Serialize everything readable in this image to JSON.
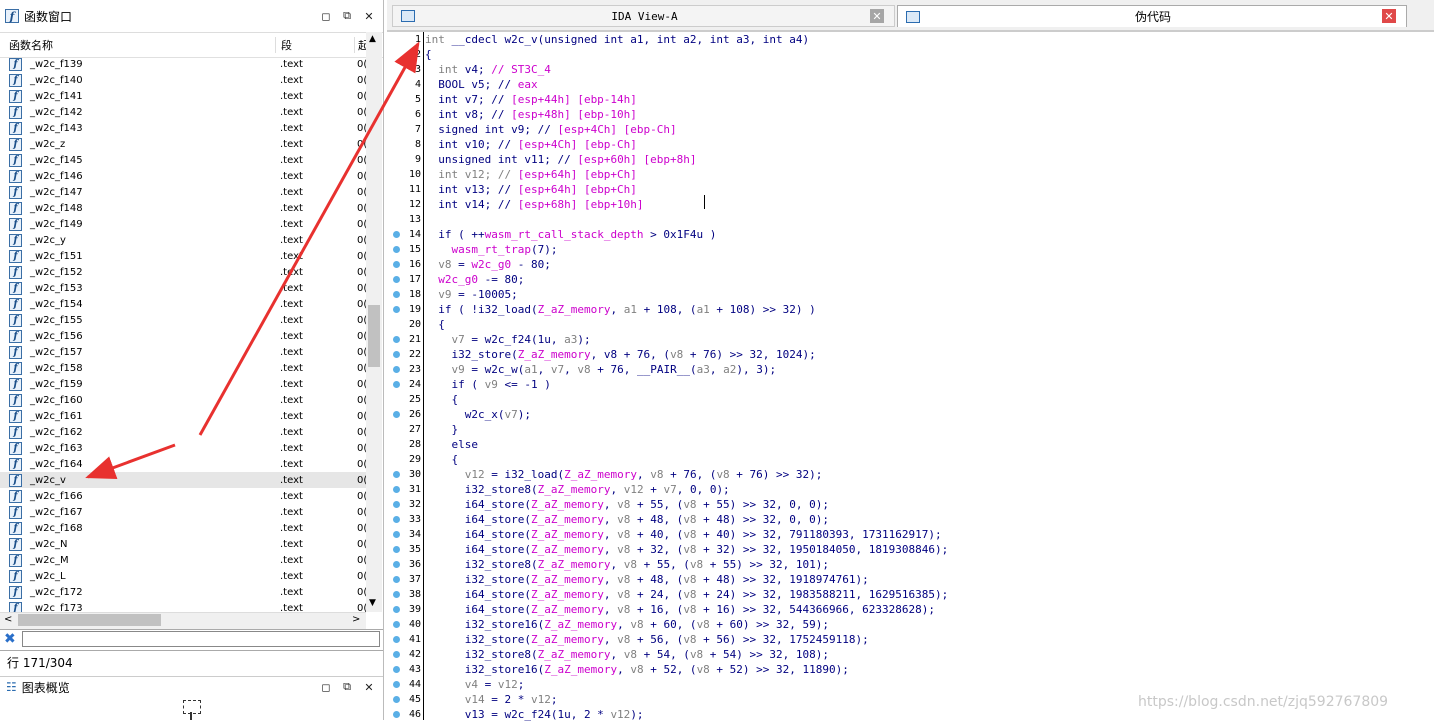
{
  "functions_window": {
    "title": "函数窗口",
    "columns": [
      "函数名称",
      "段",
      "起"
    ],
    "rows": [
      {
        "name": "_w2c_f139",
        "segment": ".text",
        "start": "0("
      },
      {
        "name": "_w2c_f140",
        "segment": ".text",
        "start": "0("
      },
      {
        "name": "_w2c_f141",
        "segment": ".text",
        "start": "0("
      },
      {
        "name": "_w2c_f142",
        "segment": ".text",
        "start": "0("
      },
      {
        "name": "_w2c_f143",
        "segment": ".text",
        "start": "0("
      },
      {
        "name": "_w2c_z",
        "segment": ".text",
        "start": "0("
      },
      {
        "name": "_w2c_f145",
        "segment": ".text",
        "start": "0("
      },
      {
        "name": "_w2c_f146",
        "segment": ".text",
        "start": "0("
      },
      {
        "name": "_w2c_f147",
        "segment": ".text",
        "start": "0("
      },
      {
        "name": "_w2c_f148",
        "segment": ".text",
        "start": "0("
      },
      {
        "name": "_w2c_f149",
        "segment": ".text",
        "start": "0("
      },
      {
        "name": "_w2c_y",
        "segment": ".text",
        "start": "0("
      },
      {
        "name": "_w2c_f151",
        "segment": ".text",
        "start": "0("
      },
      {
        "name": "_w2c_f152",
        "segment": ".text",
        "start": "0("
      },
      {
        "name": "_w2c_f153",
        "segment": ".text",
        "start": "0("
      },
      {
        "name": "_w2c_f154",
        "segment": ".text",
        "start": "0("
      },
      {
        "name": "_w2c_f155",
        "segment": ".text",
        "start": "0("
      },
      {
        "name": "_w2c_f156",
        "segment": ".text",
        "start": "0("
      },
      {
        "name": "_w2c_f157",
        "segment": ".text",
        "start": "0("
      },
      {
        "name": "_w2c_f158",
        "segment": ".text",
        "start": "0("
      },
      {
        "name": "_w2c_f159",
        "segment": ".text",
        "start": "0("
      },
      {
        "name": "_w2c_f160",
        "segment": ".text",
        "start": "0("
      },
      {
        "name": "_w2c_f161",
        "segment": ".text",
        "start": "0("
      },
      {
        "name": "_w2c_f162",
        "segment": ".text",
        "start": "0("
      },
      {
        "name": "_w2c_f163",
        "segment": ".text",
        "start": "0("
      },
      {
        "name": "_w2c_f164",
        "segment": ".text",
        "start": "0("
      },
      {
        "name": "_w2c_v",
        "segment": ".text",
        "start": "0(",
        "selected": true
      },
      {
        "name": "_w2c_f166",
        "segment": ".text",
        "start": "0("
      },
      {
        "name": "_w2c_f167",
        "segment": ".text",
        "start": "0("
      },
      {
        "name": "_w2c_f168",
        "segment": ".text",
        "start": "0("
      },
      {
        "name": "_w2c_N",
        "segment": ".text",
        "start": "0("
      },
      {
        "name": "_w2c_M",
        "segment": ".text",
        "start": "0("
      },
      {
        "name": "_w2c_L",
        "segment": ".text",
        "start": "0("
      },
      {
        "name": "_w2c_f172",
        "segment": ".text",
        "start": "0("
      },
      {
        "name": "_w2c_f173",
        "segment": ".text",
        "start": "0("
      }
    ],
    "row_status": "行 171/304"
  },
  "graph_overview": {
    "title": "图表概览"
  },
  "tabs": [
    {
      "label": "IDA View-A",
      "close_icon": "close-icon-gray"
    },
    {
      "label": "伪代码",
      "close_icon": "close-icon-red"
    }
  ],
  "code": [
    {
      "n": "1",
      "dot": false,
      "parts": [
        [
          "g",
          "int"
        ],
        [
          "k",
          " __cdecl w2c_v(unsigned int a1, int a2, int a3, int a4)"
        ]
      ]
    },
    {
      "n": "2",
      "dot": false,
      "parts": [
        [
          "k",
          "{"
        ]
      ]
    },
    {
      "n": "3",
      "dot": false,
      "parts": [
        [
          "g",
          "  int"
        ],
        [
          "k",
          " v4; "
        ],
        [
          "m",
          "// ST3C_4"
        ]
      ]
    },
    {
      "n": "4",
      "dot": false,
      "parts": [
        [
          "k",
          "  BOOL v5; // "
        ],
        [
          "m",
          "eax"
        ]
      ]
    },
    {
      "n": "5",
      "dot": false,
      "parts": [
        [
          "k",
          "  int v7; // "
        ],
        [
          "m",
          "[esp+44h] [ebp-14h]"
        ]
      ]
    },
    {
      "n": "6",
      "dot": false,
      "parts": [
        [
          "k",
          "  int v8; // "
        ],
        [
          "m",
          "[esp+48h] [ebp-10h]"
        ]
      ]
    },
    {
      "n": "7",
      "dot": false,
      "parts": [
        [
          "k",
          "  signed int v9; // "
        ],
        [
          "m",
          "[esp+4Ch] [ebp-Ch]"
        ]
      ]
    },
    {
      "n": "8",
      "dot": false,
      "parts": [
        [
          "k",
          "  int v10; // "
        ],
        [
          "m",
          "[esp+4Ch] [ebp-Ch]"
        ]
      ]
    },
    {
      "n": "9",
      "dot": false,
      "parts": [
        [
          "k",
          "  unsigned int v11; // "
        ],
        [
          "m",
          "[esp+60h] [ebp+8h]"
        ]
      ]
    },
    {
      "n": "10",
      "dot": false,
      "parts": [
        [
          "g",
          "  int v12; // "
        ],
        [
          "m",
          "[esp+64h] [ebp+Ch]"
        ]
      ]
    },
    {
      "n": "11",
      "dot": false,
      "parts": [
        [
          "k",
          "  int v13; // "
        ],
        [
          "m",
          "[esp+64h] [ebp+Ch]"
        ]
      ]
    },
    {
      "n": "12",
      "dot": false,
      "parts": [
        [
          "k",
          "  int v14; // "
        ],
        [
          "m",
          "[esp+68h] [ebp+10h]"
        ]
      ]
    },
    {
      "n": "13",
      "dot": false,
      "parts": [
        [
          "k",
          ""
        ]
      ]
    },
    {
      "n": "14",
      "dot": true,
      "parts": [
        [
          "k",
          "  if ( ++"
        ],
        [
          "m",
          "wasm_rt_call_stack_depth"
        ],
        [
          "k",
          " > 0x1F4u )"
        ]
      ]
    },
    {
      "n": "15",
      "dot": true,
      "parts": [
        [
          "m",
          "    wasm_rt_trap"
        ],
        [
          "k",
          "(7);"
        ]
      ]
    },
    {
      "n": "16",
      "dot": true,
      "parts": [
        [
          "g",
          "  v8"
        ],
        [
          "k",
          " = "
        ],
        [
          "m",
          "w2c_g0"
        ],
        [
          "k",
          " - 80;"
        ]
      ]
    },
    {
      "n": "17",
      "dot": true,
      "parts": [
        [
          "m",
          "  w2c_g0"
        ],
        [
          "k",
          " -= 80;"
        ]
      ]
    },
    {
      "n": "18",
      "dot": true,
      "parts": [
        [
          "g",
          "  v9"
        ],
        [
          "k",
          " = -10005;"
        ]
      ]
    },
    {
      "n": "19",
      "dot": true,
      "parts": [
        [
          "k",
          "  if ( !i32_load("
        ],
        [
          "m",
          "Z_aZ_memory"
        ],
        [
          "k",
          ", "
        ],
        [
          "g",
          "a1"
        ],
        [
          "k",
          " + 108, ("
        ],
        [
          "g",
          "a1"
        ],
        [
          "k",
          " + 108) >> 32) )"
        ]
      ]
    },
    {
      "n": "20",
      "dot": false,
      "parts": [
        [
          "k",
          "  {"
        ]
      ]
    },
    {
      "n": "21",
      "dot": true,
      "parts": [
        [
          "g",
          "    v7"
        ],
        [
          "k",
          " = w2c_f24(1u, "
        ],
        [
          "g",
          "a3"
        ],
        [
          "k",
          ");"
        ]
      ]
    },
    {
      "n": "22",
      "dot": true,
      "parts": [
        [
          "k",
          "    i32_store("
        ],
        [
          "m",
          "Z_aZ_memory"
        ],
        [
          "k",
          ", v8 + 76, ("
        ],
        [
          "g",
          "v8"
        ],
        [
          "k",
          " + 76) >> 32, 1024);"
        ]
      ]
    },
    {
      "n": "23",
      "dot": true,
      "parts": [
        [
          "g",
          "    v9"
        ],
        [
          "k",
          " = w2c_w("
        ],
        [
          "g",
          "a1"
        ],
        [
          "k",
          ", "
        ],
        [
          "g",
          "v7"
        ],
        [
          "k",
          ", "
        ],
        [
          "g",
          "v8"
        ],
        [
          "k",
          " + 76, __PAIR__("
        ],
        [
          "g",
          "a3"
        ],
        [
          "k",
          ", "
        ],
        [
          "g",
          "a2"
        ],
        [
          "k",
          "), 3);"
        ]
      ]
    },
    {
      "n": "24",
      "dot": true,
      "parts": [
        [
          "k",
          "    if ( "
        ],
        [
          "g",
          "v9"
        ],
        [
          "k",
          " <= -1 )"
        ]
      ]
    },
    {
      "n": "25",
      "dot": false,
      "parts": [
        [
          "k",
          "    {"
        ]
      ]
    },
    {
      "n": "26",
      "dot": true,
      "parts": [
        [
          "k",
          "      w2c_x("
        ],
        [
          "g",
          "v7"
        ],
        [
          "k",
          ");"
        ]
      ]
    },
    {
      "n": "27",
      "dot": false,
      "parts": [
        [
          "k",
          "    }"
        ]
      ]
    },
    {
      "n": "28",
      "dot": false,
      "parts": [
        [
          "k",
          "    else"
        ]
      ]
    },
    {
      "n": "29",
      "dot": false,
      "parts": [
        [
          "k",
          "    {"
        ]
      ]
    },
    {
      "n": "30",
      "dot": true,
      "parts": [
        [
          "g",
          "      v12"
        ],
        [
          "k",
          " = i32_load("
        ],
        [
          "m",
          "Z_aZ_memory"
        ],
        [
          "k",
          ", "
        ],
        [
          "g",
          "v8"
        ],
        [
          "k",
          " + 76, ("
        ],
        [
          "g",
          "v8"
        ],
        [
          "k",
          " + 76) >> 32);"
        ]
      ]
    },
    {
      "n": "31",
      "dot": true,
      "parts": [
        [
          "k",
          "      i32_store8("
        ],
        [
          "m",
          "Z_aZ_memory"
        ],
        [
          "k",
          ", "
        ],
        [
          "g",
          "v12"
        ],
        [
          "k",
          " + "
        ],
        [
          "g",
          "v7"
        ],
        [
          "k",
          ", 0, 0);"
        ]
      ]
    },
    {
      "n": "32",
      "dot": true,
      "parts": [
        [
          "k",
          "      i64_store("
        ],
        [
          "m",
          "Z_aZ_memory"
        ],
        [
          "k",
          ", "
        ],
        [
          "g",
          "v8"
        ],
        [
          "k",
          " + 55, ("
        ],
        [
          "g",
          "v8"
        ],
        [
          "k",
          " + 55) >> 32, 0, 0);"
        ]
      ]
    },
    {
      "n": "33",
      "dot": true,
      "parts": [
        [
          "k",
          "      i64_store("
        ],
        [
          "m",
          "Z_aZ_memory"
        ],
        [
          "k",
          ", "
        ],
        [
          "g",
          "v8"
        ],
        [
          "k",
          " + 48, ("
        ],
        [
          "g",
          "v8"
        ],
        [
          "k",
          " + 48) >> 32, 0, 0);"
        ]
      ]
    },
    {
      "n": "34",
      "dot": true,
      "parts": [
        [
          "k",
          "      i64_store("
        ],
        [
          "m",
          "Z_aZ_memory"
        ],
        [
          "k",
          ", "
        ],
        [
          "g",
          "v8"
        ],
        [
          "k",
          " + 40, ("
        ],
        [
          "g",
          "v8"
        ],
        [
          "k",
          " + 40) >> 32, 791180393, 1731162917);"
        ]
      ]
    },
    {
      "n": "35",
      "dot": true,
      "parts": [
        [
          "k",
          "      i64_store("
        ],
        [
          "m",
          "Z_aZ_memory"
        ],
        [
          "k",
          ", "
        ],
        [
          "g",
          "v8"
        ],
        [
          "k",
          " + 32, ("
        ],
        [
          "g",
          "v8"
        ],
        [
          "k",
          " + 32) >> 32, 1950184050, 1819308846);"
        ]
      ]
    },
    {
      "n": "36",
      "dot": true,
      "parts": [
        [
          "k",
          "      i32_store8("
        ],
        [
          "m",
          "Z_aZ_memory"
        ],
        [
          "k",
          ", "
        ],
        [
          "g",
          "v8"
        ],
        [
          "k",
          " + 55, ("
        ],
        [
          "g",
          "v8"
        ],
        [
          "k",
          " + 55) >> 32, 101);"
        ]
      ]
    },
    {
      "n": "37",
      "dot": true,
      "parts": [
        [
          "k",
          "      i32_store("
        ],
        [
          "m",
          "Z_aZ_memory"
        ],
        [
          "k",
          ", "
        ],
        [
          "g",
          "v8"
        ],
        [
          "k",
          " + 48, ("
        ],
        [
          "g",
          "v8"
        ],
        [
          "k",
          " + 48) >> 32, 1918974761);"
        ]
      ]
    },
    {
      "n": "38",
      "dot": true,
      "parts": [
        [
          "k",
          "      i64_store("
        ],
        [
          "m",
          "Z_aZ_memory"
        ],
        [
          "k",
          ", "
        ],
        [
          "g",
          "v8"
        ],
        [
          "k",
          " + 24, ("
        ],
        [
          "g",
          "v8"
        ],
        [
          "k",
          " + 24) >> 32, 1983588211, 1629516385);"
        ]
      ]
    },
    {
      "n": "39",
      "dot": true,
      "parts": [
        [
          "k",
          "      i64_store("
        ],
        [
          "m",
          "Z_aZ_memory"
        ],
        [
          "k",
          ", "
        ],
        [
          "g",
          "v8"
        ],
        [
          "k",
          " + 16, ("
        ],
        [
          "g",
          "v8"
        ],
        [
          "k",
          " + 16) >> 32, 544366966, 623328628);"
        ]
      ]
    },
    {
      "n": "40",
      "dot": true,
      "parts": [
        [
          "k",
          "      i32_store16("
        ],
        [
          "m",
          "Z_aZ_memory"
        ],
        [
          "k",
          ", "
        ],
        [
          "g",
          "v8"
        ],
        [
          "k",
          " + 60, ("
        ],
        [
          "g",
          "v8"
        ],
        [
          "k",
          " + 60) >> 32, 59);"
        ]
      ]
    },
    {
      "n": "41",
      "dot": true,
      "parts": [
        [
          "k",
          "      i32_store("
        ],
        [
          "m",
          "Z_aZ_memory"
        ],
        [
          "k",
          ", "
        ],
        [
          "g",
          "v8"
        ],
        [
          "k",
          " + 56, ("
        ],
        [
          "g",
          "v8"
        ],
        [
          "k",
          " + 56) >> 32, 1752459118);"
        ]
      ]
    },
    {
      "n": "42",
      "dot": true,
      "parts": [
        [
          "k",
          "      i32_store8("
        ],
        [
          "m",
          "Z_aZ_memory"
        ],
        [
          "k",
          ", "
        ],
        [
          "g",
          "v8"
        ],
        [
          "k",
          " + 54, ("
        ],
        [
          "g",
          "v8"
        ],
        [
          "k",
          " + 54) >> 32, 108);"
        ]
      ]
    },
    {
      "n": "43",
      "dot": true,
      "parts": [
        [
          "k",
          "      i32_store16("
        ],
        [
          "m",
          "Z_aZ_memory"
        ],
        [
          "k",
          ", "
        ],
        [
          "g",
          "v8"
        ],
        [
          "k",
          " + 52, ("
        ],
        [
          "g",
          "v8"
        ],
        [
          "k",
          " + 52) >> 32, 11890);"
        ]
      ]
    },
    {
      "n": "44",
      "dot": true,
      "parts": [
        [
          "g",
          "      v4"
        ],
        [
          "k",
          " = "
        ],
        [
          "g",
          "v12"
        ],
        [
          "k",
          ";"
        ]
      ]
    },
    {
      "n": "45",
      "dot": true,
      "parts": [
        [
          "g",
          "      v14"
        ],
        [
          "k",
          " = 2 * "
        ],
        [
          "g",
          "v12"
        ],
        [
          "k",
          ";"
        ]
      ]
    },
    {
      "n": "46",
      "dot": true,
      "parts": [
        [
          "k",
          "      v13 = w2c_f24(1u, 2 * "
        ],
        [
          "g",
          "v12"
        ],
        [
          "k",
          ");"
        ]
      ]
    }
  ],
  "watermark": "https://blog.csdn.net/zjq592767809",
  "colors": {
    "gray": "#808080",
    "magenta": "#cc00cc",
    "code": "#000080",
    "arrow": "#e8312f",
    "bp_dot": "#5aafe6"
  }
}
